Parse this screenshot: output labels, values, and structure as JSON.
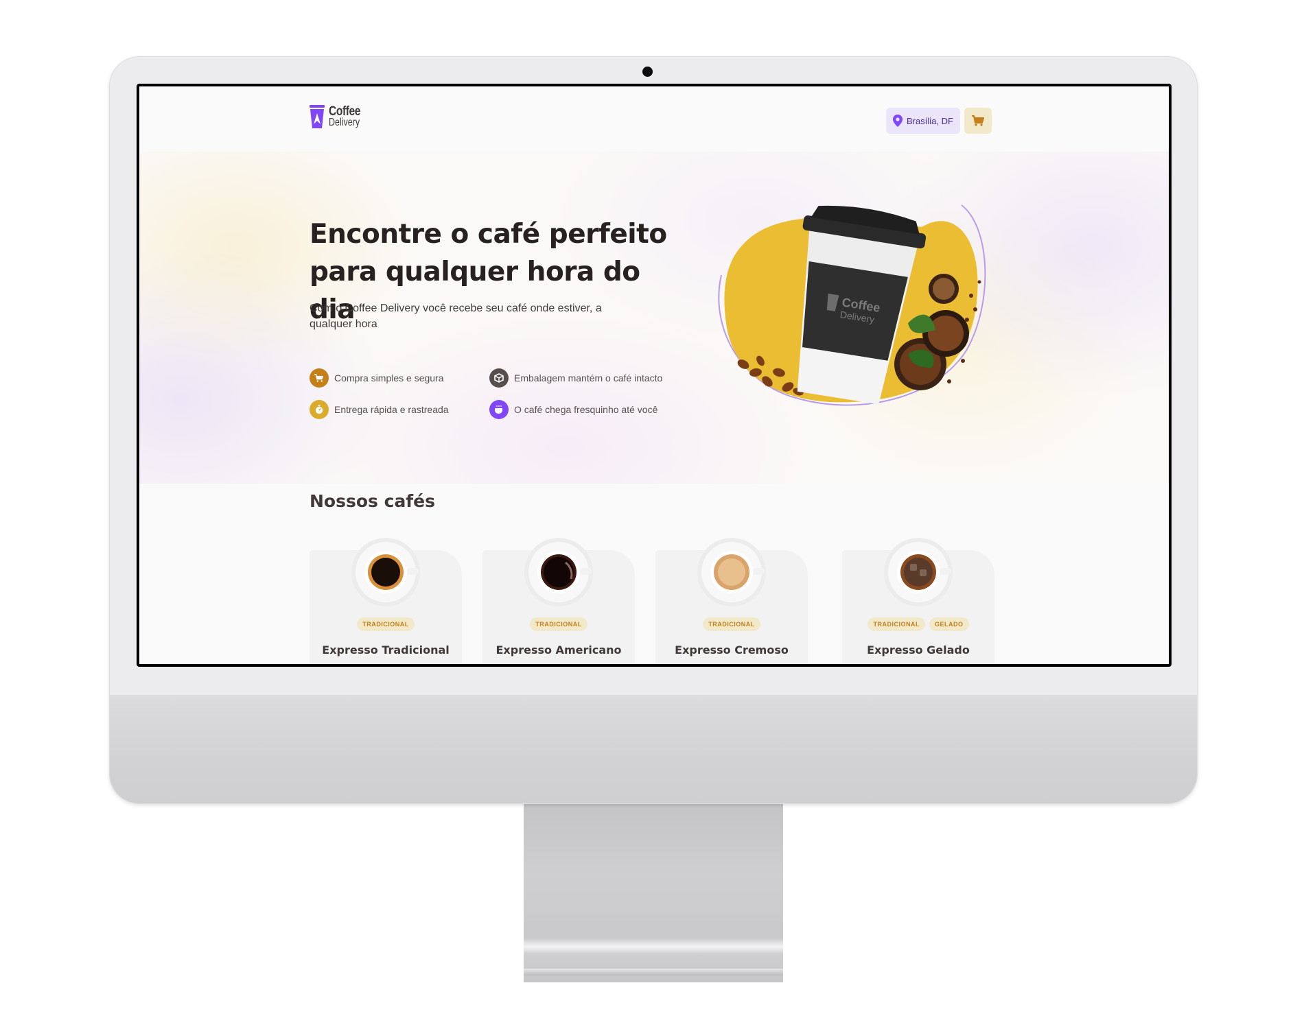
{
  "header": {
    "logo": {
      "line1": "Coffee",
      "line2": "Delivery"
    },
    "location": "Brasília, DF",
    "cart_icon": "shopping-cart-icon"
  },
  "hero": {
    "title": "Encontre o café perfeito para qualquer hora do dia",
    "subtitle": "Com o Coffee Delivery você recebe seu café onde estiver, a qualquer hora",
    "features": [
      {
        "label": "Compra simples e segura",
        "icon": "shopping-cart-icon",
        "color": "#C47F17"
      },
      {
        "label": "Embalagem mantém o café intacto",
        "icon": "package-icon",
        "color": "#574F4D"
      },
      {
        "label": "Entrega rápida e rastreada",
        "icon": "timer-icon",
        "color": "#DBAC2C"
      },
      {
        "label": "O café chega fresquinho até você",
        "icon": "coffee-icon",
        "color": "#8047F8"
      }
    ],
    "cup_brand": {
      "line1": "Coffee",
      "line2": "Delivery"
    }
  },
  "coffees": {
    "title": "Nossos cafés",
    "items": [
      {
        "name": "Expresso Tradicional",
        "tags": [
          "TRADICIONAL"
        ]
      },
      {
        "name": "Expresso Americano",
        "tags": [
          "TRADICIONAL"
        ]
      },
      {
        "name": "Expresso Cremoso",
        "tags": [
          "TRADICIONAL"
        ]
      },
      {
        "name": "Expresso Gelado",
        "tags": [
          "TRADICIONAL",
          "GELADO"
        ]
      }
    ]
  },
  "colors": {
    "purple": "#8047F8",
    "purple_dark": "#4B2995",
    "yellow": "#DBAC2C",
    "yellow_dark": "#C47F17",
    "text": "#403937"
  }
}
